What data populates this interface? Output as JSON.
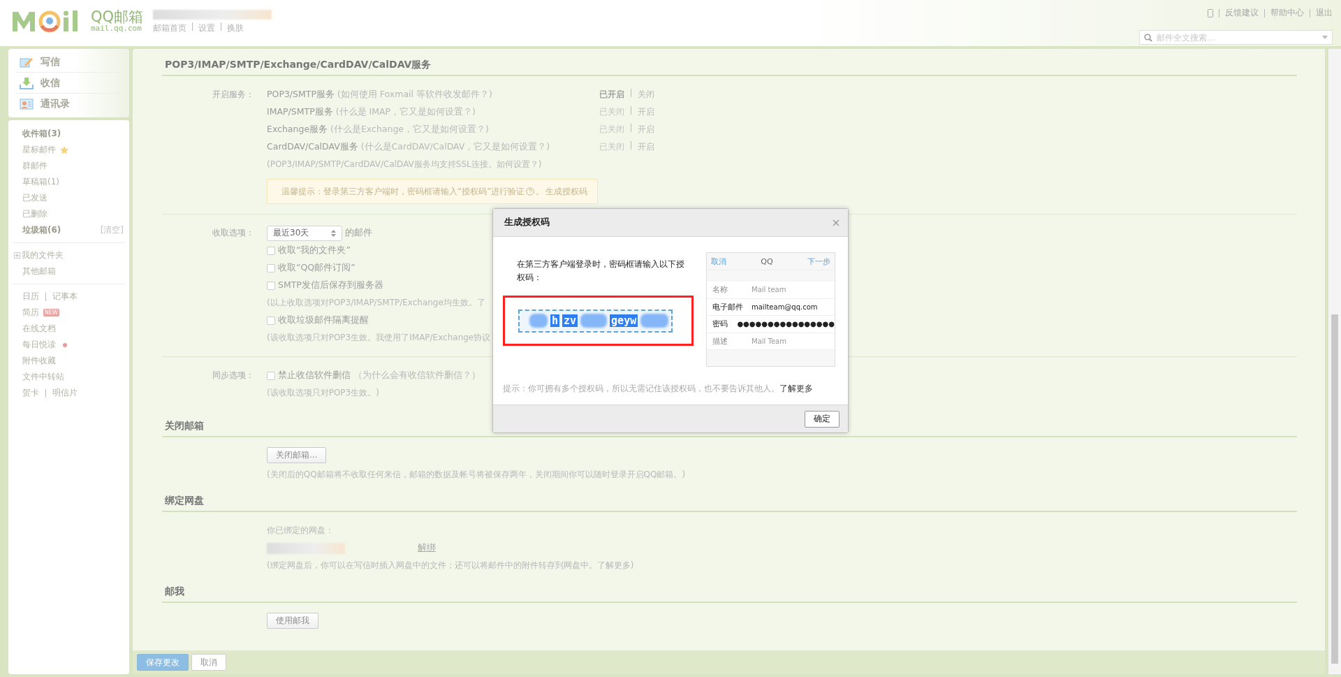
{
  "header": {
    "logo_text": "QQ邮箱",
    "logo_domain": "mail.qq.com",
    "nav": [
      {
        "label": "邮箱首页"
      },
      {
        "label": "设置"
      },
      {
        "label": "换肤"
      }
    ],
    "top_links": [
      "反馈建议",
      "帮助中心",
      "退出"
    ],
    "search": {
      "placeholder": "邮件全文搜索..."
    }
  },
  "sidebar": {
    "actions": [
      {
        "label": "写信",
        "kind": "compose"
      },
      {
        "label": "收信",
        "kind": "receive"
      },
      {
        "label": "通讯录",
        "kind": "contacts"
      }
    ],
    "groups": [
      [
        {
          "kind": "plain",
          "label": "收件箱(3)",
          "bold": true
        },
        {
          "kind": "star",
          "label": "星标邮件"
        },
        {
          "kind": "plain",
          "label": "群邮件"
        },
        {
          "kind": "plain",
          "label": "草稿箱(1)"
        },
        {
          "kind": "plain",
          "label": "已发送"
        },
        {
          "kind": "plain",
          "label": "已删除"
        },
        {
          "kind": "action",
          "label": "垃圾箱(6)",
          "bold": true,
          "action": "[清空]"
        }
      ],
      [
        {
          "kind": "tree",
          "label": "我的文件夹",
          "expanded": false
        },
        {
          "kind": "plain",
          "label": "其他邮箱"
        }
      ],
      [
        {
          "kind": "pair",
          "labels": [
            "日历",
            "记事本"
          ]
        },
        {
          "kind": "badge",
          "label": "简历",
          "badge": "NEW"
        },
        {
          "kind": "plain",
          "label": "在线文档"
        },
        {
          "kind": "dot",
          "label": "每日悦读"
        },
        {
          "kind": "plain",
          "label": "附件收藏"
        },
        {
          "kind": "plain",
          "label": "文件中转站"
        },
        {
          "kind": "pair",
          "labels": [
            "贺卡",
            "明信片"
          ]
        }
      ]
    ]
  },
  "services": {
    "title": "POP3/IMAP/SMTP/Exchange/CardDAV/CalDAV服务",
    "label": "开启服务：",
    "items": [
      {
        "name": "POP3/SMTP服务",
        "help": "(如何使用 Foxmail 等软件收发邮件？)",
        "status": "已开启",
        "action": "关闭",
        "on": true
      },
      {
        "name": "IMAP/SMTP服务",
        "help": "(什么是 IMAP，它又是如何设置？)",
        "status": "已关闭",
        "action": "开启",
        "on": false
      },
      {
        "name": "Exchange服务",
        "help": "(什么是Exchange，它又是如何设置？)",
        "status": "已关闭",
        "action": "开启",
        "on": false
      },
      {
        "name": "CardDAV/CalDAV服务",
        "help": "(什么是CardDAV/CalDAV，它又是如何设置？)",
        "status": "已关闭",
        "action": "开启",
        "on": false
      }
    ],
    "note": "(POP3/IMAP/SMTP/CardDAV/CalDAV服务均支持SSL连接。如何设置？)",
    "tip": {
      "text": "温馨提示：登录第三方客户端时，密码框请输入“授权码”进行验证",
      "suffix": "。",
      "link": "生成授权码"
    }
  },
  "receive": {
    "label": "收取选项：",
    "select": {
      "value": "最近30天"
    },
    "select_suffix": "的邮件",
    "items": [
      {
        "kind": "checkbox",
        "label": "收取“我的文件夹”",
        "checked": false
      },
      {
        "kind": "checkbox",
        "label": "收取“QQ邮件订阅”",
        "checked": false
      },
      {
        "kind": "checkbox",
        "label": "SMTP发信后保存到服务器",
        "checked": false
      },
      {
        "kind": "note",
        "label": "(以上收取选项对POP3/IMAP/SMTP/Exchange均生效。了"
      },
      {
        "kind": "checkbox",
        "label": "收取垃圾邮件隔离提醒",
        "checked": false
      },
      {
        "kind": "note",
        "label": "(该收取选项只对POP3生效。我使用了IMAP/Exchange协议"
      }
    ]
  },
  "sync": {
    "label": "同步选项：",
    "checkbox": {
      "label": "禁止收信软件删信",
      "checked": false
    },
    "help": "（为什么会有收信软件删信？）",
    "note": "(该收取选项只对POP3生效。)"
  },
  "close_mailbox": {
    "title": "关闭邮箱",
    "button": "关闭邮箱...",
    "note": "(关闭后的QQ邮箱将不收取任何来信，邮箱的数据及帐号将被保存两年，关闭期间你可以随时登录开启QQ邮箱。)"
  },
  "netdisk": {
    "title": "绑定网盘",
    "label": "你已绑定的网盘：",
    "link": "解绑",
    "note": "(绑定网盘后，你可以在写信时插入网盘中的文件；还可以将邮件中的附件转存到网盘中。了解更多)"
  },
  "mail_me": {
    "title": "邮我",
    "button": "使用邮我"
  },
  "footer": {
    "buttons": [
      {
        "label": "保存更改",
        "kind": "primary"
      },
      {
        "label": "取消",
        "kind": "plain"
      }
    ]
  },
  "dialog": {
    "title": "生成授权码",
    "instruction": "在第三方客户端登录时，密码框请输入以下授权码：",
    "code_fragments": [
      "h",
      "zv",
      "geyw"
    ],
    "preview": {
      "header": [
        "取消",
        "QQ",
        "下一步"
      ],
      "fields": [
        {
          "label": "名称",
          "value": "Mail team",
          "filled": false
        },
        {
          "label": "电子邮件",
          "value": "mailteam@qq.com",
          "filled": true
        },
        {
          "label": "密码",
          "value": "●●●●●●●●●●●●●●●●",
          "filled": true
        },
        {
          "label": "描述",
          "value": "Mail Team",
          "filled": false
        }
      ]
    },
    "hint": "提示：你可拥有多个授权码，所以无需记住该授权码，也不要告诉其他人。",
    "hint_link": "了解更多",
    "button": "确定"
  }
}
